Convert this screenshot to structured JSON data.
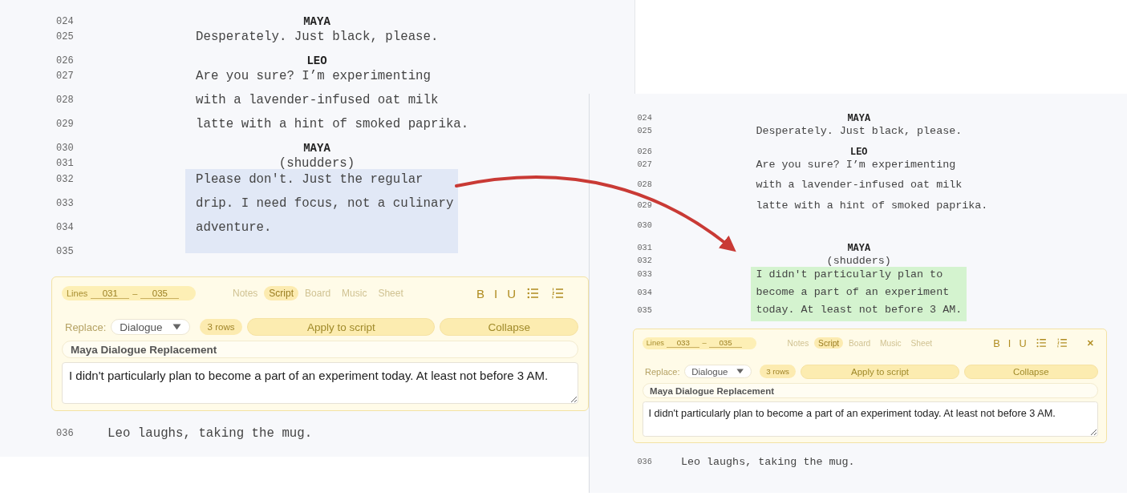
{
  "panels": [
    {
      "rows": [
        {
          "number": "024",
          "kind": "character",
          "text": "MAYA"
        },
        {
          "number": "025",
          "kind": "dialogue",
          "text": "Desperately. Just black, please."
        },
        {
          "number": "026",
          "kind": "character",
          "text": "LEO"
        },
        {
          "number": "027",
          "kind": "dialogue",
          "text": "Are you sure? I’m experimenting"
        },
        {
          "number": "028",
          "kind": "dialogue",
          "text": "with a lavender-infused oat milk"
        },
        {
          "number": "029",
          "kind": "dialogue",
          "text": "latte with a hint of smoked paprika."
        },
        {
          "number": "030",
          "kind": "character",
          "text": "MAYA"
        },
        {
          "number": "031",
          "kind": "parenthetical",
          "text": "(shudders)"
        },
        {
          "number": "032",
          "kind": "dialogue",
          "text": "Please don't. Just the regular",
          "selected": true
        },
        {
          "number": "033",
          "kind": "dialogue",
          "text": "drip. I need focus, not a culinary",
          "selected": true
        },
        {
          "number": "034",
          "kind": "dialogue",
          "text": "adventure.",
          "selected": true
        },
        {
          "number": "035",
          "kind": "blank",
          "selected": true
        }
      ],
      "editor": {
        "range_label": "Lines",
        "range_from": "031",
        "range_separator": "–",
        "range_to": "035",
        "tabs": [
          {
            "label": "Notes",
            "selected": false
          },
          {
            "label": "Script",
            "selected": true
          },
          {
            "label": "Board",
            "selected": false
          },
          {
            "label": "Music",
            "selected": false
          },
          {
            "label": "Sheet",
            "selected": false
          }
        ],
        "format_buttons": [
          {
            "kind": "bold",
            "label": "B"
          },
          {
            "kind": "italic",
            "label": "I"
          },
          {
            "kind": "underline",
            "label": "U"
          },
          {
            "kind": "bullets"
          },
          {
            "kind": "numbered"
          }
        ],
        "close_button": false,
        "replace_label": "Replace:",
        "replace_value": "Dialogue",
        "rows_badge": "3 rows",
        "buttons": [
          "Apply to script",
          "Collapse"
        ],
        "title_value": "Maya Dialogue Replacement",
        "text_value": "I didn't particularly plan to become a part of an experiment today. At least not before 3 AM."
      },
      "trailing_rows": [
        {
          "number": "036",
          "kind": "action",
          "text": "Leo laughs, taking the mug."
        }
      ]
    },
    {
      "rows": [
        {
          "number": "024",
          "kind": "character",
          "text": "MAYA"
        },
        {
          "number": "025",
          "kind": "dialogue",
          "text": "Desperately. Just black, please."
        },
        {
          "number": "026",
          "kind": "character",
          "text": "LEO"
        },
        {
          "number": "027",
          "kind": "dialogue",
          "text": "Are you sure? I’m experimenting"
        },
        {
          "number": "028",
          "kind": "dialogue",
          "text": "with a lavender-infused oat milk"
        },
        {
          "number": "029",
          "kind": "dialogue",
          "text": "latte with a hint of smoked paprika."
        },
        {
          "number": "030",
          "kind": "blank"
        },
        {
          "number": "031",
          "kind": "character",
          "text": "MAYA"
        },
        {
          "number": "032",
          "kind": "parenthetical",
          "text": "(shudders)"
        },
        {
          "number": "033",
          "kind": "dialogue",
          "text": "I didn't particularly plan to",
          "replaced": true
        },
        {
          "number": "034",
          "kind": "dialogue",
          "text": "become a part of an experiment",
          "replaced": true
        },
        {
          "number": "035",
          "kind": "dialogue",
          "text": "today. At least not before 3 AM.",
          "replaced": true
        }
      ],
      "editor": {
        "range_label": "Lines",
        "range_from": "033",
        "range_separator": "–",
        "range_to": "035",
        "tabs": [
          {
            "label": "Notes",
            "selected": false
          },
          {
            "label": "Script",
            "selected": true
          },
          {
            "label": "Board",
            "selected": false
          },
          {
            "label": "Music",
            "selected": false
          },
          {
            "label": "Sheet",
            "selected": false
          }
        ],
        "format_buttons": [
          {
            "kind": "bold",
            "label": "B"
          },
          {
            "kind": "italic",
            "label": "I"
          },
          {
            "kind": "underline",
            "label": "U"
          },
          {
            "kind": "bullets"
          },
          {
            "kind": "numbered"
          }
        ],
        "close_button": true,
        "replace_label": "Replace:",
        "replace_value": "Dialogue",
        "rows_badge": "3 rows",
        "buttons": [
          "Apply to script",
          "Collapse"
        ],
        "title_value": "Maya Dialogue Replacement",
        "text_value": "I didn't particularly plan to become a part of an experiment today. At least not before 3 AM."
      },
      "trailing_rows": [
        {
          "number": "036",
          "kind": "action",
          "text": "Leo laughs, taking the mug."
        }
      ]
    }
  ]
}
